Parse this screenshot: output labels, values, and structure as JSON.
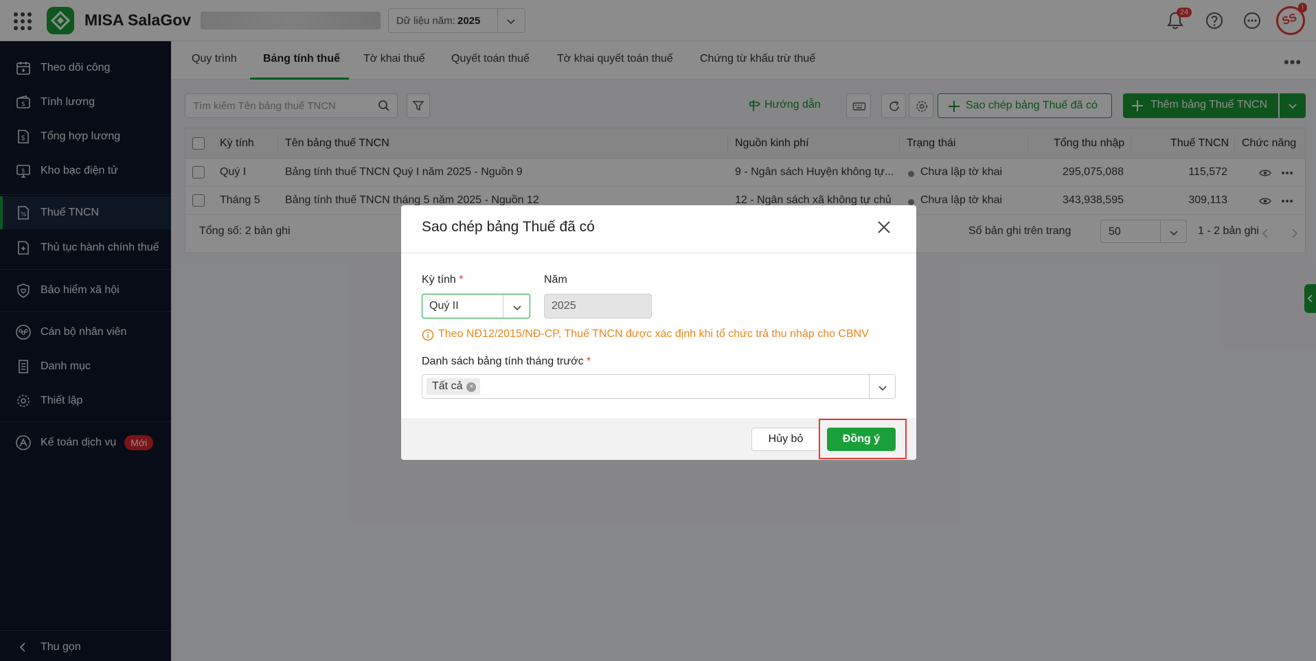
{
  "header": {
    "app_name": "MISA SalaGov",
    "year_label": "Dữ liệu năm:",
    "year_value": "2025",
    "notification_count": "24",
    "avatar_badge": "!",
    "avatar_text": "SS"
  },
  "sidebar": {
    "items": [
      {
        "label": "Theo dõi công",
        "icon": "calendar-icon"
      },
      {
        "label": "Tính lương",
        "icon": "wallet-icon"
      },
      {
        "label": "Tổng hợp lương",
        "icon": "document-dollar-icon"
      },
      {
        "label": "Kho bạc điện tử",
        "icon": "monitor-dollar-icon"
      },
      {
        "label": "Thuế TNCN",
        "icon": "document-percent-icon",
        "active": true
      },
      {
        "label": "Thủ tục hành chính thuế",
        "icon": "document-plus-icon"
      },
      {
        "label": "Bảo hiểm xã hội",
        "icon": "shield-heart-icon"
      },
      {
        "label": "Cán bộ nhân viên",
        "icon": "people-icon"
      },
      {
        "label": "Danh mục",
        "icon": "list-icon"
      },
      {
        "label": "Thiết lập",
        "icon": "gear-icon"
      },
      {
        "label": "Kế toán dịch vụ",
        "icon": "accounting-icon",
        "badge": "Mới"
      }
    ],
    "collapse_label": "Thu gọn"
  },
  "tabs": [
    "Quy trình",
    "Bảng tính thuế",
    "Tờ khai thuế",
    "Quyết toán thuế",
    "Tờ khai quyết toán thuế",
    "Chứng từ khấu trừ thuế"
  ],
  "toolbar": {
    "search_placeholder": "Tìm kiếm Tên bảng thuế TNCN",
    "guide_label": "Hướng dẫn",
    "copy_label": "Sao chép bảng Thuế đã có",
    "add_label": "Thêm bảng Thuế TNCN"
  },
  "table": {
    "columns": [
      "Kỳ tính",
      "Tên bảng thuế TNCN",
      "Nguồn kinh phí",
      "Trạng thái",
      "Tổng thu nhập",
      "Thuế TNCN",
      "Chức năng"
    ],
    "rows": [
      {
        "period": "Quý I",
        "name": "Bảng tính thuế TNCN Quý I năm 2025 - Nguồn 9",
        "source": "9 - Ngân sách Huyện không tự...",
        "status": "Chưa lập tờ khai",
        "income": "295,075,088",
        "tax": "115,572"
      },
      {
        "period": "Tháng 5",
        "name": "Bảng tính thuế TNCN tháng 5 năm 2025 - Nguồn 12",
        "source": "12 - Ngân sách xã không tự chủ",
        "status": "Chưa lập tờ khai",
        "income": "343,938,595",
        "tax": "309,113"
      }
    ],
    "total_label": "Tổng số: 2 bản ghi",
    "page_size_label": "Số bản ghi trên trang",
    "page_size": "50",
    "range_label": "1 - 2 bản ghi"
  },
  "dialog": {
    "title": "Sao chép bảng Thuế đã có",
    "period_label": "Kỳ tính",
    "period_value": "Quý II",
    "year_label": "Năm",
    "year_value": "2025",
    "notice": "Theo NĐ12/2015/NĐ-CP, Thuế TNCN được xác định khi tổ chức trả thu nhập cho CBNV",
    "list_label": "Danh sách bảng tính tháng trước",
    "list_tag": "Tất cả",
    "cancel_label": "Hủy bỏ",
    "ok_label": "Đồng ý"
  },
  "colors": {
    "brand_green": "#1aa03a",
    "sidebar_bg": "#0d1629",
    "warning": "#e8861a",
    "danger": "#e53935"
  }
}
